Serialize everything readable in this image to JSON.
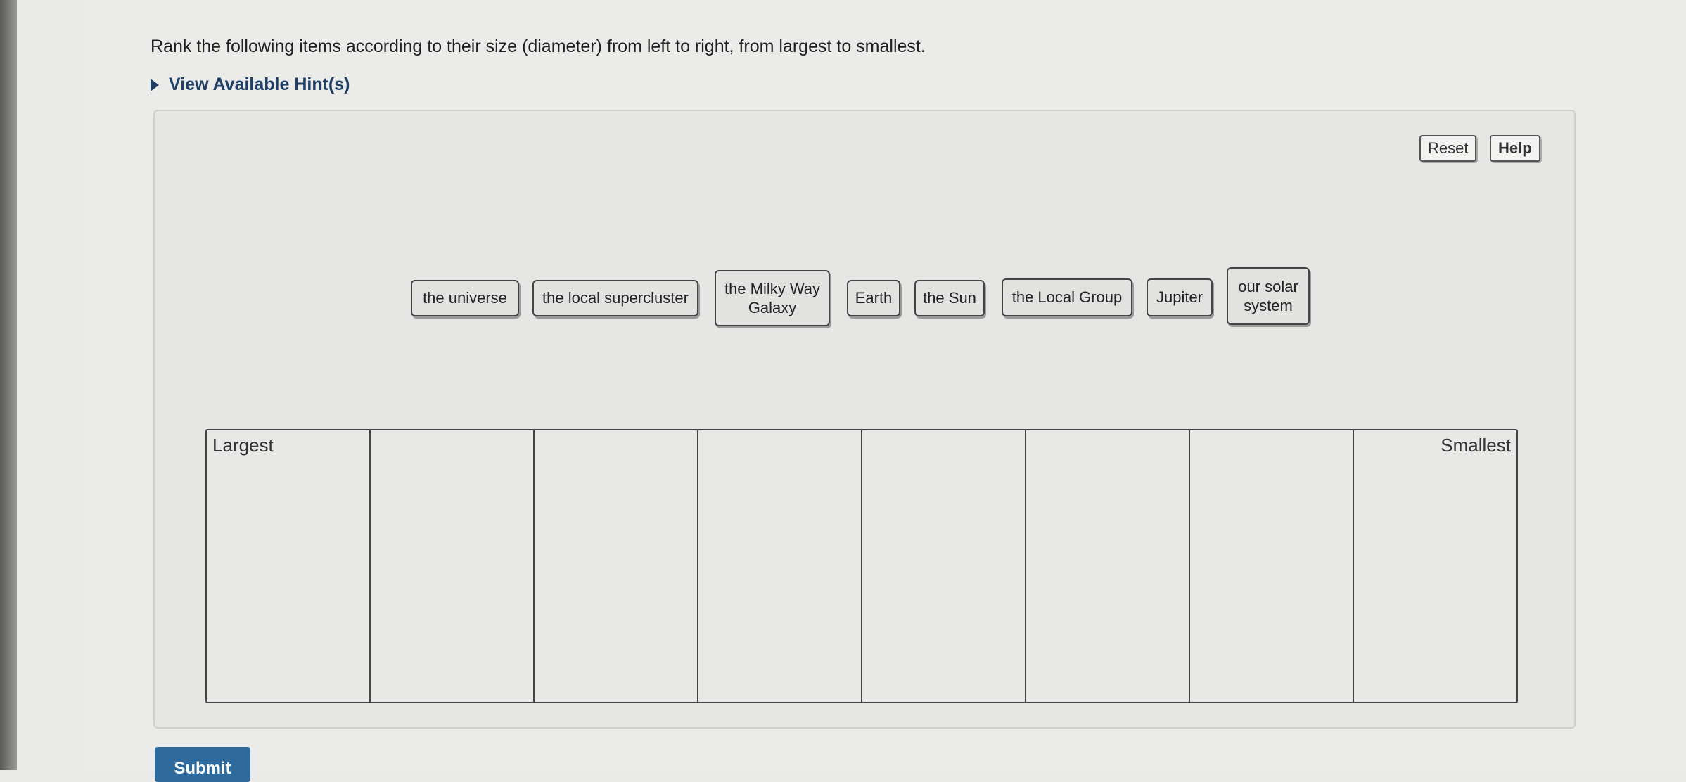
{
  "question": "Rank the following items according to their size (diameter) from left to right, from largest to smallest.",
  "hints_label": "View Available Hint(s)",
  "toolbar": {
    "reset_label": "Reset",
    "help_label": "Help"
  },
  "items": [
    "the universe",
    "the local supercluster",
    "the Milky Way Galaxy",
    "Earth",
    "the Sun",
    "the Local Group",
    "Jupiter",
    "our solar system"
  ],
  "ranking": {
    "left_label": "Largest",
    "right_label": "Smallest",
    "slots": 8
  },
  "submit_label": "Submit"
}
